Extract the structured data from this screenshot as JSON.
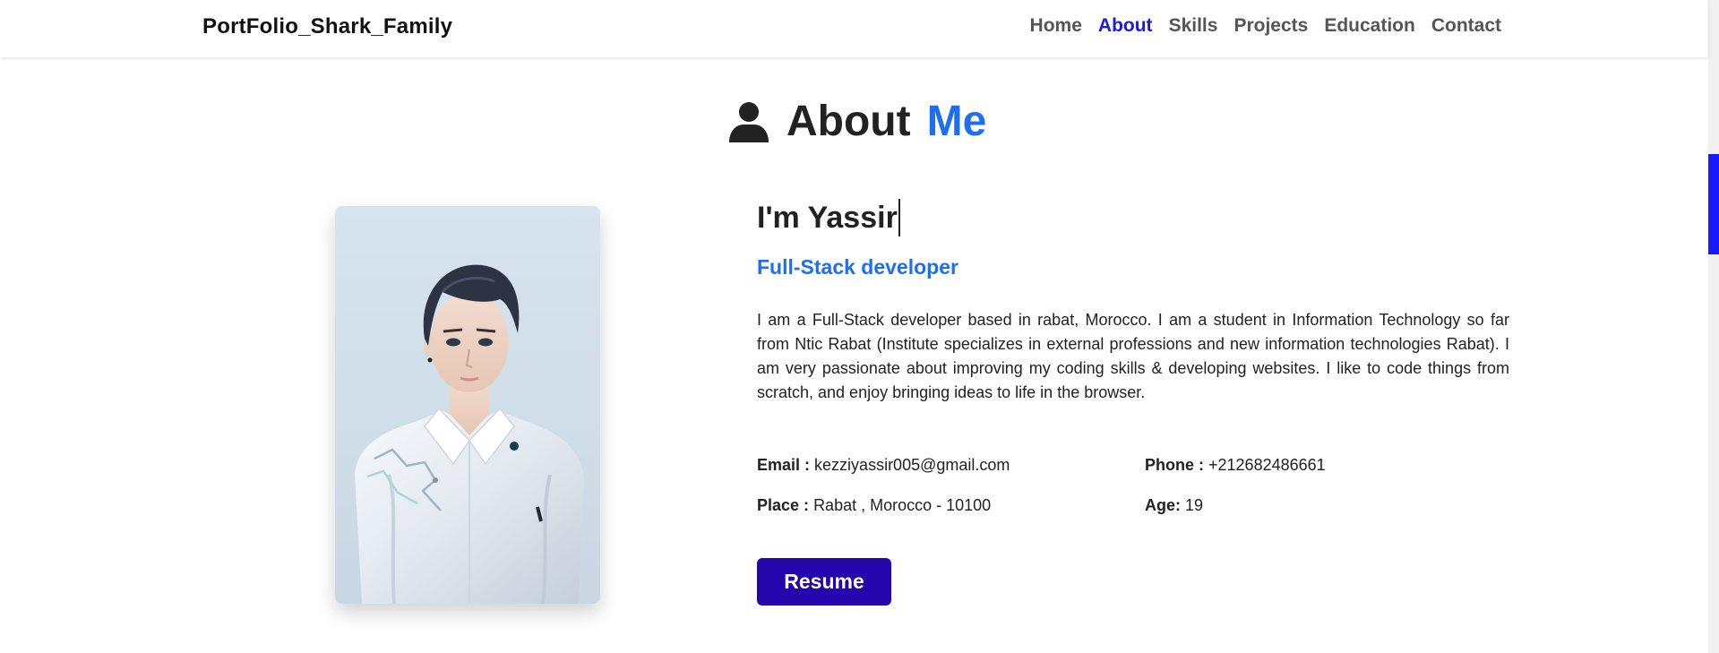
{
  "navbar": {
    "brand": "PortFolio_Shark_Family",
    "links": [
      {
        "label": "Home",
        "active": false
      },
      {
        "label": "About",
        "active": true
      },
      {
        "label": "Skills",
        "active": false
      },
      {
        "label": "Projects",
        "active": false
      },
      {
        "label": "Education",
        "active": false
      },
      {
        "label": "Contact",
        "active": false
      }
    ]
  },
  "about": {
    "heading_main": "About",
    "heading_accent": "Me",
    "greeting": "I'm Yassir",
    "role": "Full-Stack developer",
    "bio": "I am a Full-Stack developer based in rabat, Morocco. I am a student in Information Technology so far from Ntic Rabat (Institute specializes in external professions and new information technologies Rabat). I am very passionate about improving my coding skills & developing websites. I like to code things from scratch, and enjoy bringing ideas to life in the browser.",
    "info": {
      "email_label": "Email :",
      "email_value": "kezziyassir005@gmail.com",
      "phone_label": "Phone :",
      "phone_value": "+212682486661",
      "place_label": "Place :",
      "place_value": "Rabat , Morocco - 10100",
      "age_label": "Age:",
      "age_value": "19"
    },
    "resume_label": "Resume"
  },
  "icons": {
    "heading_icon": "user-icon"
  },
  "colors": {
    "accent": "#1d6ef2",
    "nav_active": "#1a1adb",
    "button": "#2506ad",
    "scroll_thumb": "#1a1aff"
  }
}
